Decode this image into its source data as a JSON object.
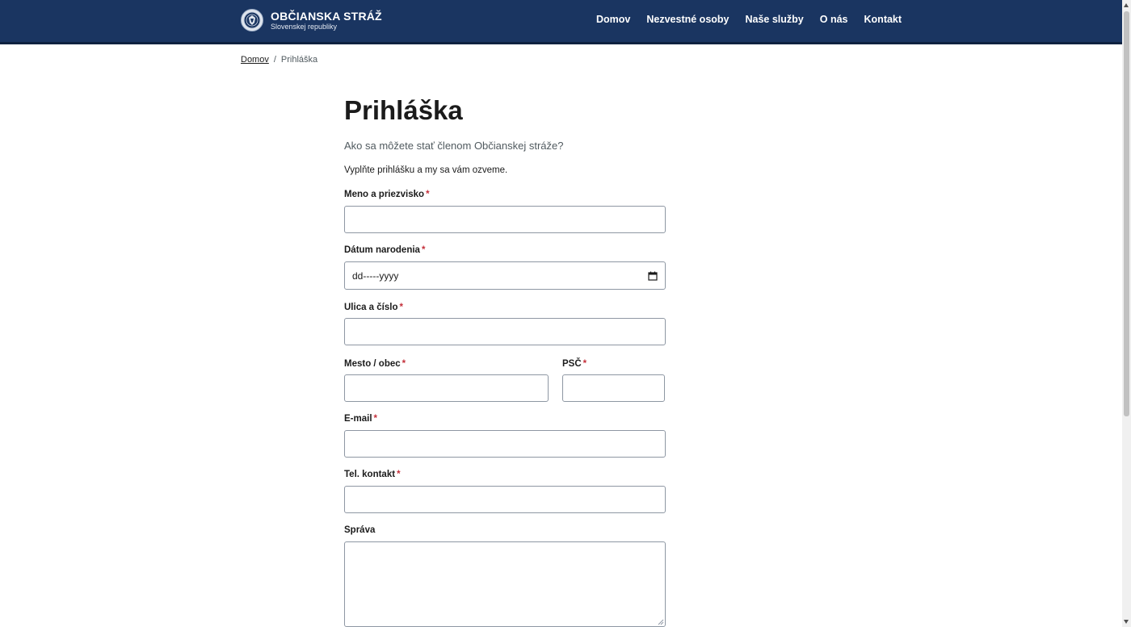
{
  "header": {
    "brand_title": "OBČIANSKA STRÁŽ",
    "brand_subtitle": "Slovenskej republiky",
    "logo_icon": "shield-emblem-icon",
    "nav": [
      {
        "label": "Domov"
      },
      {
        "label": "Nezvestné osoby"
      },
      {
        "label": "Naše služby"
      },
      {
        "label": "O nás"
      },
      {
        "label": "Kontakt"
      }
    ]
  },
  "breadcrumb": {
    "home": "Domov",
    "separator": "/",
    "current": "Prihláška"
  },
  "page": {
    "title": "Prihláška",
    "intro": "Ako sa môžete stať členom Občianskej stráže?",
    "hint": "Vyplňte prihlášku a my sa vám ozveme."
  },
  "form": {
    "required_mark": "*",
    "name": {
      "label": "Meno a priezvisko",
      "value": ""
    },
    "birthdate": {
      "label": "Dátum narodenia",
      "placeholder": "dd-----yyyy",
      "icon": "calendar-icon"
    },
    "street": {
      "label": "Ulica a číslo",
      "value": ""
    },
    "city": {
      "label": "Mesto / obec",
      "value": ""
    },
    "zip": {
      "label": "PSČ",
      "value": ""
    },
    "email": {
      "label": "E-mail",
      "value": ""
    },
    "phone": {
      "label": "Tel. kontakt",
      "value": ""
    },
    "message": {
      "label": "Správa",
      "value": ""
    }
  },
  "colors": {
    "header_bg": "#1a3561",
    "required": "#c4303b",
    "muted_text": "#505a5f",
    "border": "#8e97a3"
  }
}
